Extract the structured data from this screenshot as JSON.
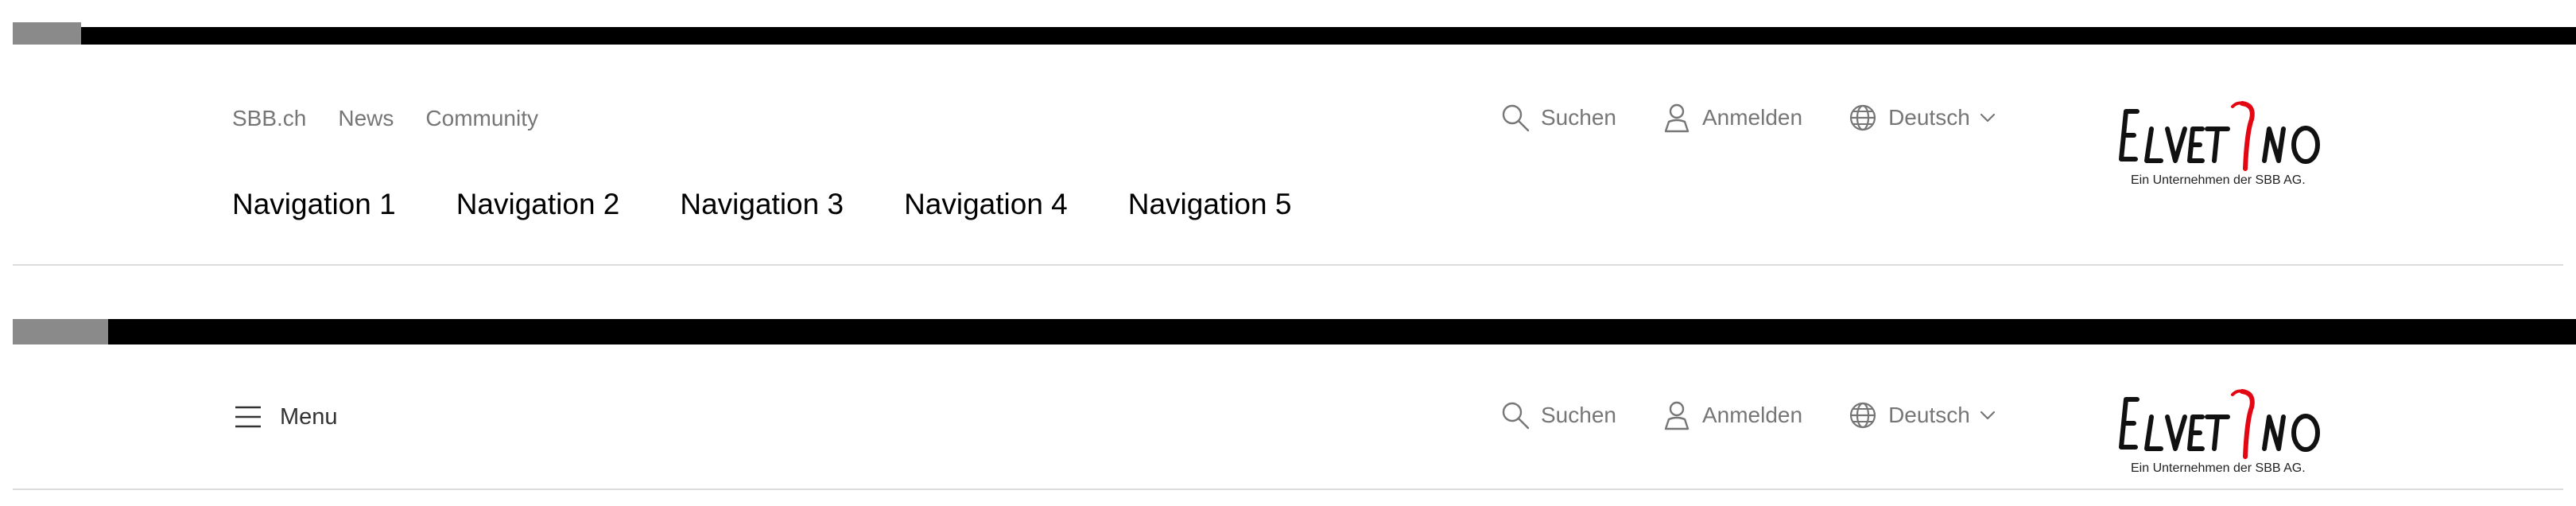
{
  "meta_nav": [
    "SBB.ch",
    "News",
    "Community"
  ],
  "main_nav": [
    "Navigation 1",
    "Navigation 2",
    "Navigation 3",
    "Navigation 4",
    "Navigation 5"
  ],
  "tools": {
    "search_label": "Suchen",
    "login_label": "Anmelden",
    "language_label": "Deutsch",
    "menu_label": "Menu"
  },
  "logo": {
    "brand": "ELVETINO",
    "tagline": "Ein Unternehmen der SBB AG."
  },
  "colors": {
    "text_muted": "#767676",
    "divider": "#dcdcdc",
    "logo_accent": "#e30613",
    "topbar": "#000000"
  },
  "icons": [
    "search-icon",
    "user-icon",
    "globe-icon",
    "chevron-down-icon",
    "menu-icon"
  ]
}
